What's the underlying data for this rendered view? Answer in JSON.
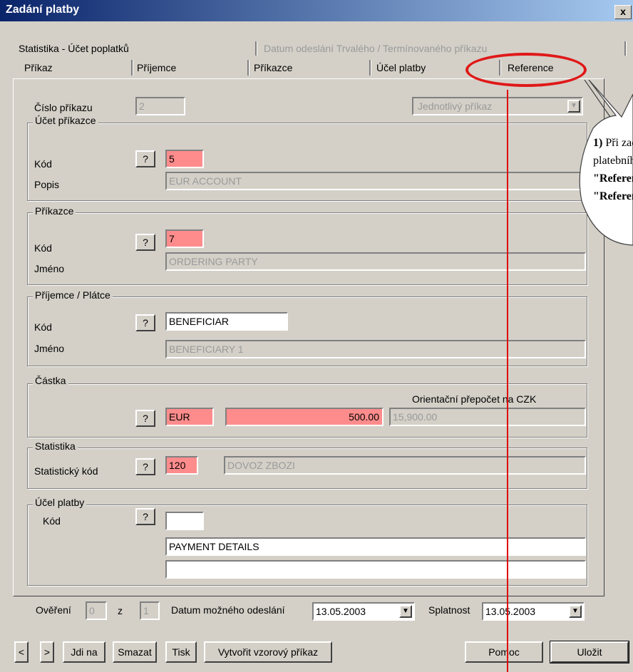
{
  "window": {
    "title": "Zadání platby",
    "close_label": "x"
  },
  "tabs_row1": [
    {
      "label": "Statistika - Účet poplatků",
      "enabled": true
    },
    {
      "label": "Datum odeslání Trvalého / Termínovaného příkazu",
      "enabled": false
    }
  ],
  "tabs_row2": [
    {
      "label": "Příkaz"
    },
    {
      "label": "Příjemce"
    },
    {
      "label": "Příkazce"
    },
    {
      "label": "Účel platby"
    },
    {
      "label": "Reference"
    }
  ],
  "order": {
    "number_label": "Číslo příkazu",
    "number_value": "2",
    "type_value": "Jednotlivý příkaz"
  },
  "ucet_prikazce": {
    "title": "Účet příkazce",
    "code_label": "Kód",
    "code_value": "5",
    "desc_label": "Popis",
    "desc_value": "EUR ACCOUNT"
  },
  "prikazce": {
    "title": "Příkazce",
    "code_label": "Kód",
    "code_value": "7",
    "name_label": "Jméno",
    "name_value": "ORDERING PARTY"
  },
  "prijemce": {
    "title": "Příjemce / Plátce",
    "code_label": "Kód",
    "code_value": "BENEFICIAR",
    "name_label": "Jméno",
    "name_value": "BENEFICIARY 1"
  },
  "castka": {
    "title": "Částka",
    "conversion_label": "Orientační přepočet na CZK",
    "currency": "EUR",
    "amount": "500.00",
    "czk_value": "15,900.00"
  },
  "statistika": {
    "title": "Statistika",
    "code_label": "Statistický kód",
    "code_value": "120",
    "desc_value": "DOVOZ ZBOZI"
  },
  "ucel": {
    "title": "Účel platby",
    "code_label": "Kód",
    "code_value": "",
    "line1": "PAYMENT DETAILS",
    "line2": ""
  },
  "footer": {
    "overeni_label": "Ověření",
    "overeni_value": "0",
    "z_label": "z",
    "z_value": "1",
    "datum_label": "Datum možného odeslání",
    "datum_value": "13.05.2003",
    "splatnost_label": "Splatnost",
    "splatnost_value": "13.05.2003"
  },
  "buttons": {
    "prev": "<",
    "next": ">",
    "jdi_na": "Jdi na",
    "smazat": "Smazat",
    "tisk": "Tisk",
    "vytvorit": "Vytvořit vzorový příkaz",
    "pomoc": "Pomoc",
    "ulozit": "Uložit",
    "help": "?"
  },
  "callout": {
    "line1_num": "1)",
    "line1": " Při zadáv",
    "line2": "platebního p",
    "line3": "\"Reference",
    "line4": "\"Reference"
  },
  "colors": {
    "required_field": "#ff8c8c",
    "annotation": "#e01818",
    "title_bar": "#0a246a"
  }
}
